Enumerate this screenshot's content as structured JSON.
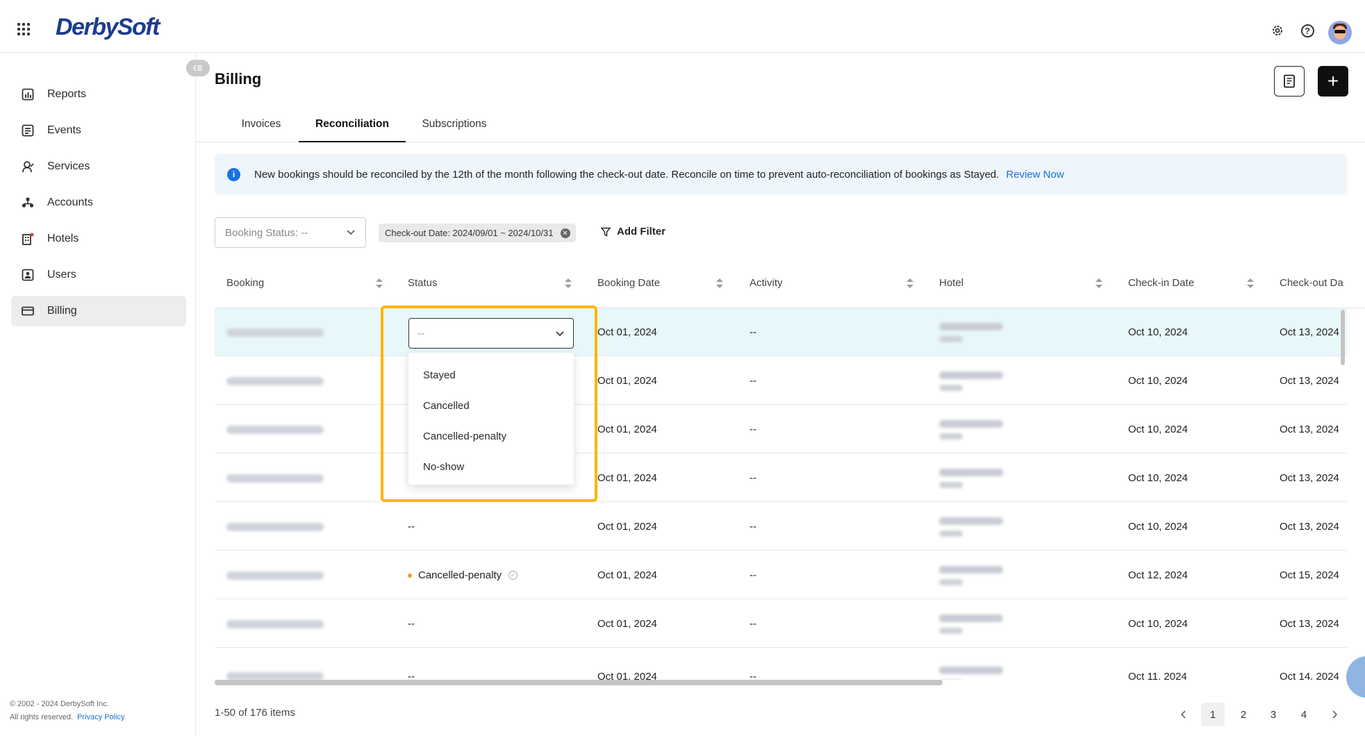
{
  "brand": {
    "name": "DerbySoft"
  },
  "sidebar": {
    "items": [
      {
        "label": "Reports",
        "icon": "report-icon"
      },
      {
        "label": "Events",
        "icon": "events-icon"
      },
      {
        "label": "Services",
        "icon": "services-icon"
      },
      {
        "label": "Accounts",
        "icon": "accounts-icon"
      },
      {
        "label": "Hotels",
        "icon": "hotel-icon"
      },
      {
        "label": "Users",
        "icon": "users-icon"
      },
      {
        "label": "Billing",
        "icon": "billing-icon",
        "active": true
      }
    ],
    "footer": {
      "copyright": "© 2002 - 2024 DerbySoft Inc.",
      "rights": "All rights reserved.",
      "privacy": "Privacy Policy"
    }
  },
  "page": {
    "title": "Billing"
  },
  "tabs": [
    {
      "label": "Invoices"
    },
    {
      "label": "Reconciliation",
      "active": true
    },
    {
      "label": "Subscriptions"
    }
  ],
  "banner": {
    "text": "New bookings should be reconciled by the 12th of the month following the check-out date. Reconcile on time to prevent auto-reconciliation of bookings as Stayed.",
    "link": "Review Now"
  },
  "filters": {
    "booking_status": "Booking Status: --",
    "chip": "Check-out Date: 2024/09/01 ~ 2024/10/31",
    "add_filter": "Add Filter"
  },
  "table": {
    "columns": [
      "Booking",
      "Status",
      "Booking Date",
      "Activity",
      "Hotel",
      "Check-in Date",
      "Check-out Da"
    ],
    "rows": [
      {
        "status": "",
        "booking_date": "Oct 01, 2024",
        "activity": "--",
        "checkin": "Oct 10, 2024",
        "checkout": "Oct 13, 2024"
      },
      {
        "status": "",
        "booking_date": "Oct 01, 2024",
        "activity": "--",
        "checkin": "Oct 10, 2024",
        "checkout": "Oct 13, 2024"
      },
      {
        "status": "",
        "booking_date": "Oct 01, 2024",
        "activity": "--",
        "checkin": "Oct 10, 2024",
        "checkout": "Oct 13, 2024"
      },
      {
        "status": "",
        "booking_date": "Oct 01, 2024",
        "activity": "--",
        "checkin": "Oct 10, 2024",
        "checkout": "Oct 13, 2024"
      },
      {
        "status": "--",
        "booking_date": "Oct 01, 2024",
        "activity": "--",
        "checkin": "Oct 10, 2024",
        "checkout": "Oct 13, 2024"
      },
      {
        "status": "Cancelled-penalty",
        "booking_date": "Oct 01, 2024",
        "activity": "--",
        "checkin": "Oct 12, 2024",
        "checkout": "Oct 15, 2024"
      },
      {
        "status": "--",
        "booking_date": "Oct 01, 2024",
        "activity": "--",
        "checkin": "Oct 10, 2024",
        "checkout": "Oct 13, 2024"
      },
      {
        "status": "--",
        "booking_date": "Oct 01, 2024",
        "activity": "--",
        "checkin": "Oct 11, 2024",
        "checkout": "Oct 14, 2024"
      }
    ]
  },
  "status_dropdown": {
    "value": "--",
    "options": [
      "Stayed",
      "Cancelled",
      "Cancelled-penalty",
      "No-show"
    ]
  },
  "pagination": {
    "summary": "1-50 of 176 items",
    "pages": [
      "1",
      "2",
      "3",
      "4"
    ],
    "current": "1"
  },
  "colors": {
    "highlight": "#ffb400",
    "accent": "#1a6fd6",
    "row_highlight": "#e8f8fa",
    "status_dot": "#f29a2e"
  }
}
